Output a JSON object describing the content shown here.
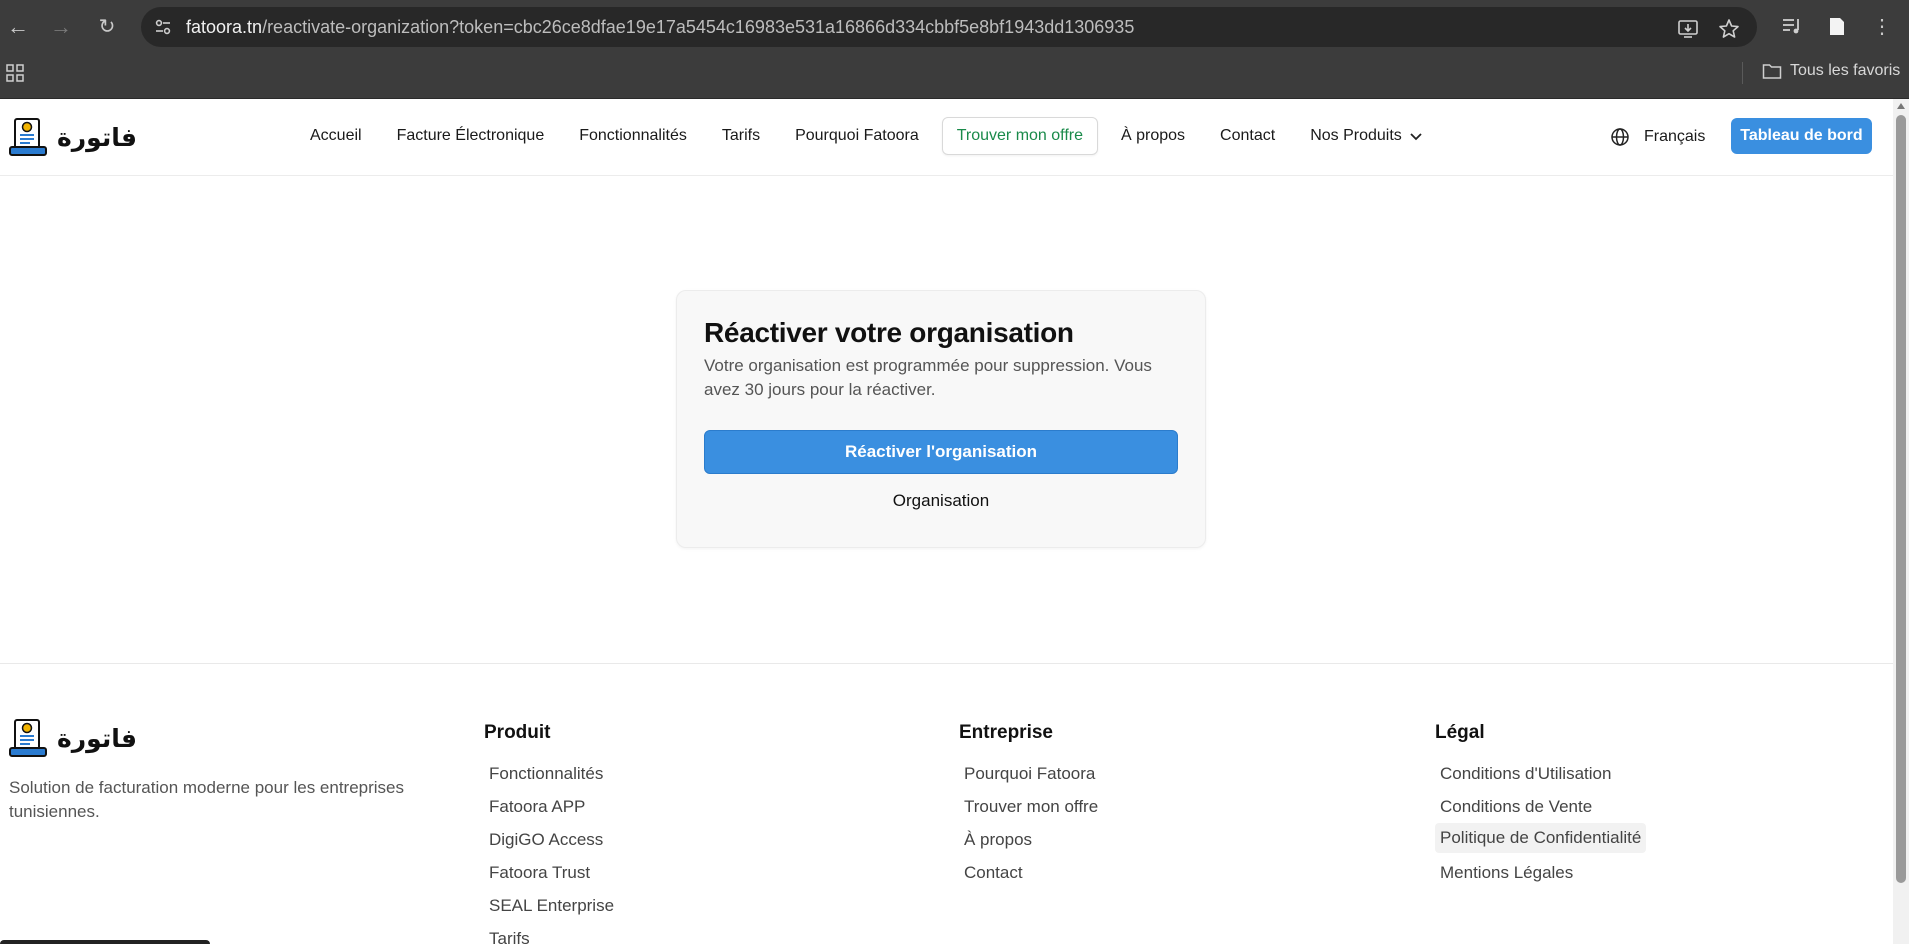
{
  "browser": {
    "url_host": "fatoora.tn",
    "url_path": "/reactivate-organization?token=cbc26ce8dfae19e17a5454c16983e531a16866d334cbbf5e8bf1943dd1306935",
    "bookmarks_folder": "Tous les favoris"
  },
  "header": {
    "logo_text": "فاتورة",
    "nav": [
      {
        "label": "Accueil"
      },
      {
        "label": "Facture Électronique"
      },
      {
        "label": "Fonctionnalités"
      },
      {
        "label": "Tarifs"
      },
      {
        "label": "Pourquoi Fatoora"
      },
      {
        "label": "Trouver mon offre"
      },
      {
        "label": "À propos"
      },
      {
        "label": "Contact"
      },
      {
        "label": "Nos Produits"
      }
    ],
    "language": "Français",
    "dashboard_button": "Tableau de bord"
  },
  "card": {
    "title": "Réactiver votre organisation",
    "description": "Votre organisation est programmée pour suppression. Vous avez 30 jours pour la réactiver.",
    "primary_button": "Réactiver l'organisation",
    "secondary_link": "Organisation"
  },
  "footer": {
    "logo_text": "فاتورة",
    "tagline": "Solution de facturation moderne pour les entreprises tunisiennes.",
    "columns": [
      {
        "title": "Produit",
        "links": [
          "Fonctionnalités",
          "Fatoora APP",
          "DigiGO Access",
          "Fatoora Trust",
          "SEAL Enterprise",
          "Tarifs"
        ]
      },
      {
        "title": "Entreprise",
        "links": [
          "Pourquoi Fatoora",
          "Trouver mon offre",
          "À propos",
          "Contact"
        ]
      },
      {
        "title": "Légal",
        "links": [
          "Conditions d'Utilisation",
          "Conditions de Vente",
          "Politique de Confidentialité",
          "Mentions Légales"
        ]
      }
    ]
  },
  "colors": {
    "primary": "#3a8fe0",
    "highlight_green": "#1a8a4a",
    "chrome_dark": "#3c3c3c"
  }
}
